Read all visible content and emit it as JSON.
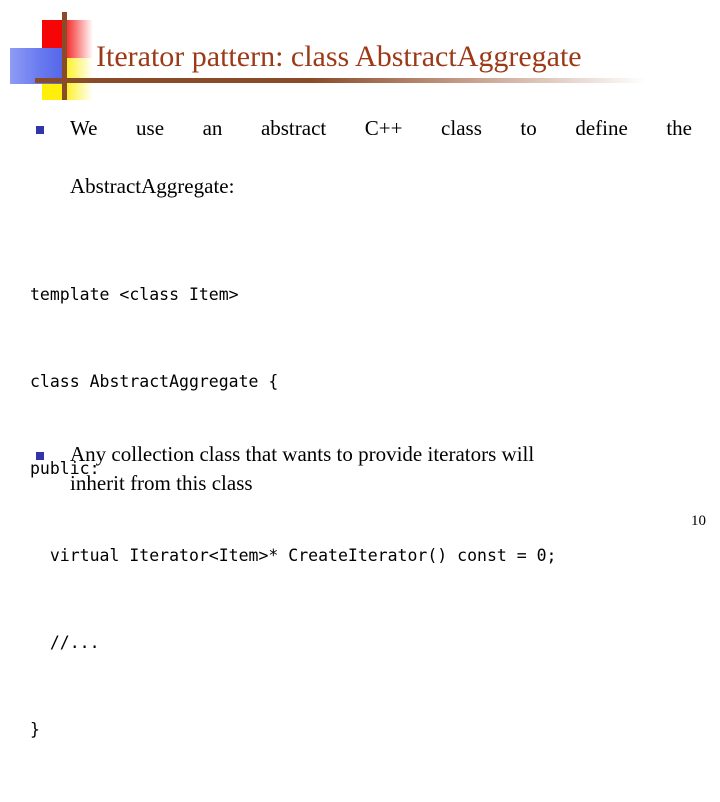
{
  "slide": {
    "title": "Iterator pattern: class AbstractAggregate",
    "page_number": "10",
    "accent_color": "#9c3a17",
    "bullet_color": "#3333aa",
    "rule_color": "#8a4b28"
  },
  "logo": {
    "red_square": "#f50505",
    "yellow_square": "#ffef0a",
    "blue_rectangle": "#6a7bf0",
    "cross_color": "#8a4b28"
  },
  "bullets": [
    {
      "marker": "square-bullet",
      "line1": "We use an abstract C++ class to define the",
      "line2": "AbstractAggregate:"
    },
    {
      "marker": "square-bullet",
      "line1": "Any collection class that wants to provide iterators will",
      "line2": "inherit from this class"
    }
  ],
  "code": {
    "lines": [
      "template <class Item>",
      "class AbstractAggregate {",
      "public:",
      "  virtual Iterator<Item>* CreateIterator() const = 0;",
      "  //...",
      "}"
    ]
  }
}
